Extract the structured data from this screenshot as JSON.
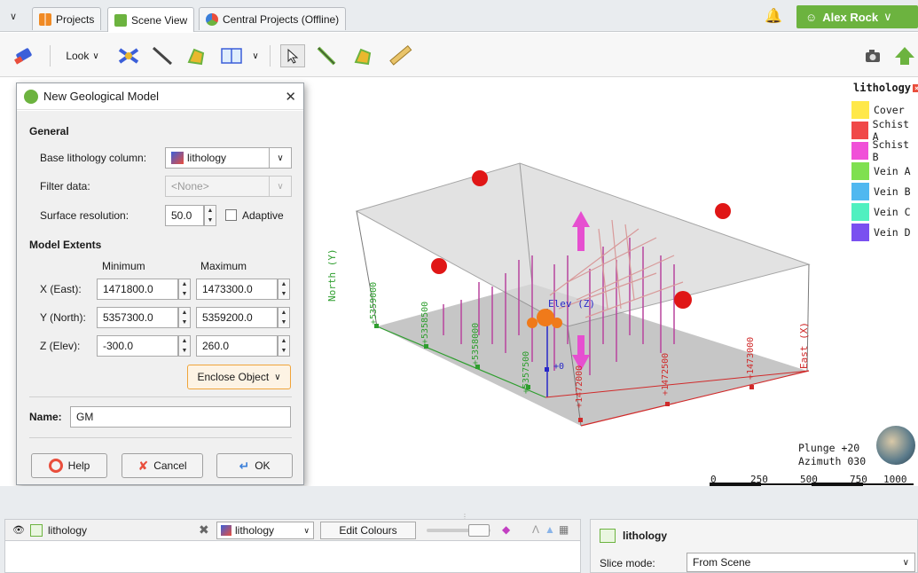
{
  "tabs": [
    {
      "label": "Projects",
      "active": false
    },
    {
      "label": "Scene View",
      "active": true
    },
    {
      "label": "Central Projects (Offline)",
      "active": false
    }
  ],
  "user": {
    "name": "Alex Rock"
  },
  "toolbar": {
    "look_label": "Look"
  },
  "dialog": {
    "title": "New Geological Model",
    "general_heading": "General",
    "base_lithology_label": "Base lithology column:",
    "base_lithology_value": "lithology",
    "filter_label": "Filter data:",
    "filter_value": "<None>",
    "surface_res_label": "Surface resolution:",
    "surface_res_value": "50.0",
    "adaptive_label": "Adaptive",
    "extents_heading": "Model Extents",
    "min_header": "Minimum",
    "max_header": "Maximum",
    "rows": [
      {
        "label": "X (East):",
        "min": "1471800.0",
        "max": "1473300.0"
      },
      {
        "label": "Y (North):",
        "min": "5357300.0",
        "max": "5359200.0"
      },
      {
        "label": "Z (Elev):",
        "min": "-300.0",
        "max": "260.0"
      }
    ],
    "enclose_label": "Enclose Object",
    "name_label": "Name:",
    "name_value": "GM",
    "help_label": "Help",
    "cancel_label": "Cancel",
    "ok_label": "OK"
  },
  "legend": {
    "title": "lithology",
    "items": [
      {
        "label": "Cover",
        "color": "#ffe84a"
      },
      {
        "label": "Schist A",
        "color": "#f04848"
      },
      {
        "label": "Schist B",
        "color": "#f050d8"
      },
      {
        "label": "Vein A",
        "color": "#7fe050"
      },
      {
        "label": "Vein B",
        "color": "#50b8f0"
      },
      {
        "label": "Vein C",
        "color": "#50f0c0"
      },
      {
        "label": "Vein D",
        "color": "#7a50f0"
      }
    ]
  },
  "scene": {
    "north_label": "North (Y)",
    "east_label": "East (X)",
    "elev_label": "Elev (Z)",
    "north_ticks": [
      "+5359000",
      "+5358500",
      "+5358000",
      "+5357500"
    ],
    "east_ticks": [
      "+1472000",
      "+1472500",
      "+1473000"
    ],
    "z_tick": "+0",
    "plunge": "Plunge +20",
    "azimuth": "Azimuth 030",
    "scale_ticks": [
      "0",
      "250",
      "500",
      "750",
      "1000"
    ]
  },
  "bottom_left": {
    "layer_name": "lithology",
    "column_value": "lithology",
    "edit_colours": "Edit Colours"
  },
  "bottom_right": {
    "title": "lithology",
    "slice_mode_label": "Slice mode:",
    "slice_mode_value": "From Scene"
  }
}
